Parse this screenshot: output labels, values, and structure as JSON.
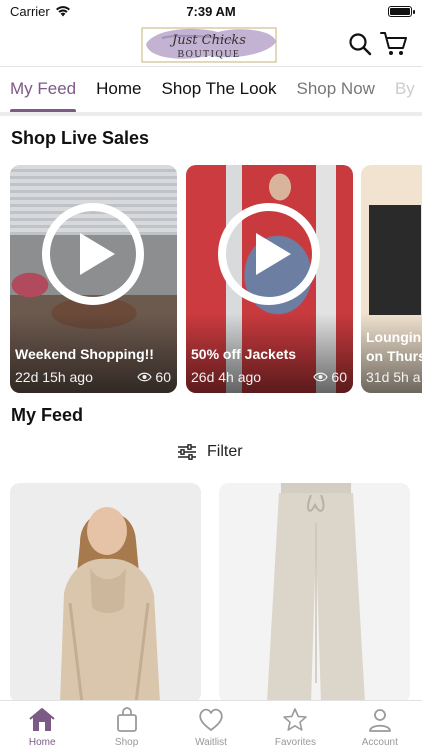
{
  "status_bar": {
    "carrier": "Carrier",
    "time": "7:39 AM"
  },
  "header": {
    "logo_line1": "Just Chicks",
    "logo_line2": "BOUTIQUE",
    "brand_color": "#7c5a86"
  },
  "tabs": [
    {
      "label": "My Feed",
      "active": true
    },
    {
      "label": "Home"
    },
    {
      "label": "Shop The Look"
    },
    {
      "label": "Shop Now"
    },
    {
      "label": "By"
    }
  ],
  "live_section": {
    "title": "Shop Live Sales",
    "cards": [
      {
        "title": "Weekend Shopping!!",
        "age": "22d 15h ago",
        "views": "60"
      },
      {
        "title": "50% off Jackets",
        "age": "26d 4h ago",
        "views": "60"
      },
      {
        "title": "Lounging",
        "title_line2": "on Thurs",
        "age": "31d 5h a"
      }
    ]
  },
  "feed": {
    "title": "My Feed",
    "filter_label": "Filter"
  },
  "bottom_nav": [
    {
      "label": "Home",
      "icon": "home-icon",
      "active": true
    },
    {
      "label": "Shop",
      "icon": "bag-icon"
    },
    {
      "label": "Waitlist",
      "icon": "heart-icon"
    },
    {
      "label": "Favorites",
      "icon": "star-icon"
    },
    {
      "label": "Account",
      "icon": "person-icon"
    }
  ]
}
